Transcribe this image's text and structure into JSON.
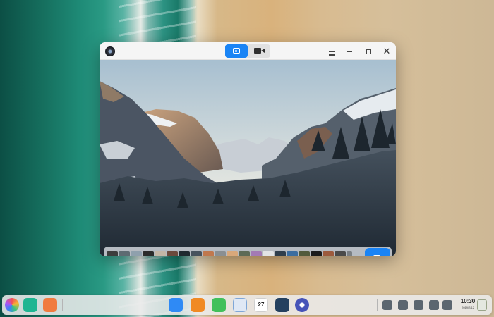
{
  "camera_window": {
    "modes": {
      "photo": "camera-icon",
      "video": "video-camera-icon"
    },
    "active_mode": "photo",
    "window_controls": [
      "menu-icon",
      "minimize-icon",
      "maximize-icon",
      "close-icon"
    ]
  },
  "filmstrip": {
    "thumbnail_count": 26,
    "shutter_icon": "camera-icon"
  },
  "dock": {
    "apps": [
      "launcher-icon",
      "multitasking-icon",
      "workspace-icon",
      "app-store-icon",
      "file-manager-icon",
      "music-icon",
      "document-viewer-icon",
      "calendar-icon",
      "mountain-app-icon",
      "settings-icon"
    ],
    "calendar_day": "27",
    "clock": {
      "time": "10:30",
      "date": "2019/7/12"
    }
  },
  "colors": {
    "accent": "#1a84f5"
  }
}
